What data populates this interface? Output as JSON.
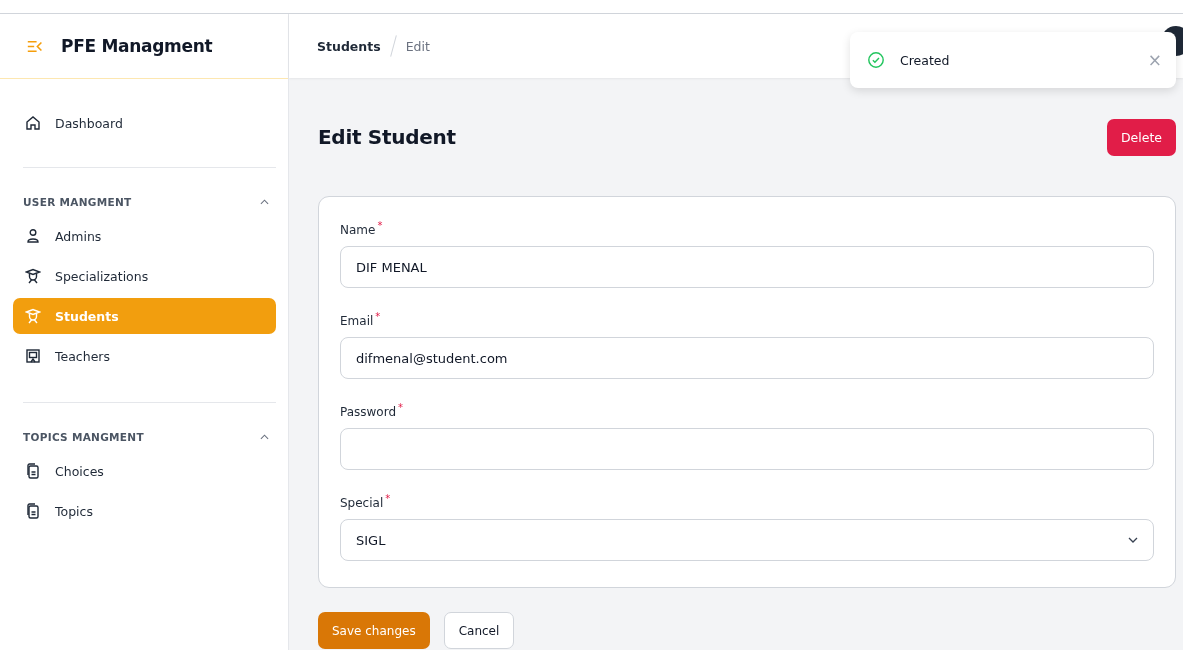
{
  "brand": {
    "title": "PFE Managment"
  },
  "sidebar": {
    "sections": [
      {
        "items": [
          {
            "label": "Dashboard",
            "selected": false
          }
        ]
      },
      {
        "title": "USER MANGMENT",
        "expanded": true,
        "items": [
          {
            "label": "Admins",
            "selected": false
          },
          {
            "label": "Specializations",
            "selected": false
          },
          {
            "label": "Students",
            "selected": true
          },
          {
            "label": "Teachers",
            "selected": false
          }
        ]
      },
      {
        "title": "TOPICS MANGMENT",
        "expanded": true,
        "items": [
          {
            "label": "Choices",
            "selected": false
          },
          {
            "label": "Topics",
            "selected": false
          }
        ]
      }
    ]
  },
  "breadcrumb": [
    "Students",
    "Edit"
  ],
  "toast": {
    "message": "Created",
    "close": "×"
  },
  "page": {
    "title": "Edit Student",
    "delete_button": "Delete"
  },
  "form": {
    "fields": [
      {
        "kind": "text",
        "label": "Name",
        "required_mark": "*",
        "value": "DIF MENAL"
      },
      {
        "kind": "text",
        "label": "Email",
        "required_mark": "*",
        "value": "difmenal@student.com"
      },
      {
        "kind": "password",
        "label": "Password",
        "required_mark": "*"
      },
      {
        "kind": "select",
        "label": "Special",
        "required_mark": "*",
        "value": "SIGL"
      }
    ]
  },
  "actions": {
    "save": "Save changes",
    "cancel": "Cancel"
  }
}
